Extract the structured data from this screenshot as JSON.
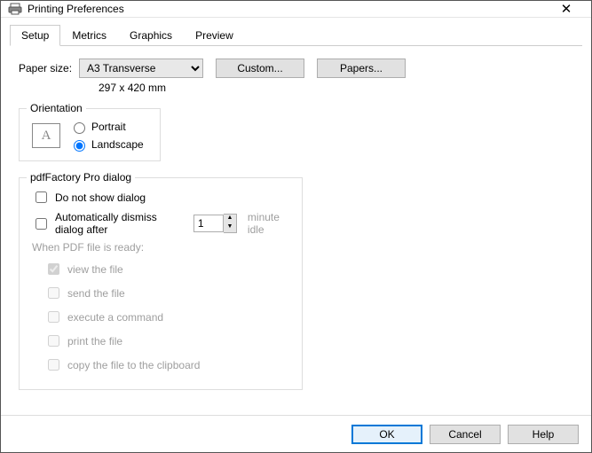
{
  "window": {
    "title": "Printing Preferences",
    "close_icon": "✕"
  },
  "tabs": {
    "setup": "Setup",
    "metrics": "Metrics",
    "graphics": "Graphics",
    "preview": "Preview"
  },
  "paper": {
    "size_label": "Paper size:",
    "size_value": "A3 Transverse",
    "dimensions": "297 x 420 mm",
    "custom_btn": "Custom...",
    "papers_btn": "Papers..."
  },
  "orientation": {
    "legend": "Orientation",
    "page_glyph": "A",
    "portrait": "Portrait",
    "landscape": "Landscape",
    "selected": "landscape"
  },
  "pdf": {
    "legend": "pdfFactory Pro dialog",
    "do_not_show": "Do not show dialog",
    "auto_dismiss": "Automatically dismiss dialog after",
    "auto_dismiss_value": "1",
    "minute_idle": "minute idle",
    "when_ready": "When PDF file is ready:",
    "view": "view the file",
    "send": "send the file",
    "execute": "execute a command",
    "print": "print the file",
    "copy": "copy the file to the clipboard"
  },
  "footer": {
    "ok": "OK",
    "cancel": "Cancel",
    "help": "Help"
  }
}
